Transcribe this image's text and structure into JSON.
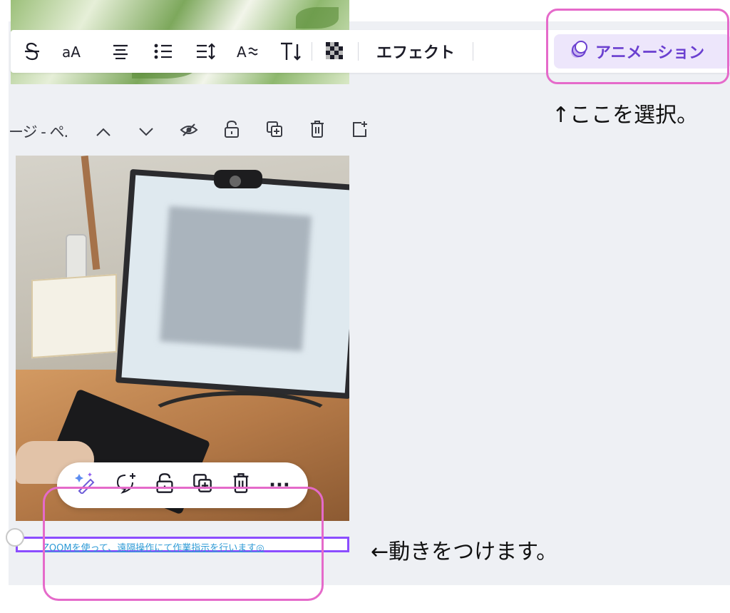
{
  "toolbar": {
    "icons": [
      "strikethrough-icon",
      "letter-case-icon",
      "align-icon",
      "list-icon",
      "spacing-icon",
      "font-style-icon",
      "text-direction-icon"
    ],
    "effects_label": "エフェクト",
    "animation_label": "アニメーション"
  },
  "annotations": {
    "top_note": "↑ここを選択。",
    "bottom_note": "←動きをつけます。"
  },
  "page_controls": {
    "label": "ージ - ペ.",
    "icons": [
      "chevron-up-icon",
      "chevron-down-icon",
      "hide-icon",
      "lock-icon",
      "duplicate-icon",
      "delete-icon",
      "add-page-icon"
    ]
  },
  "canvas_text": {
    "line": "ZOOMを使って、遠隔操作にて作業指示を行います◎"
  },
  "floating_toolbar": {
    "icons": [
      "magic-edit-icon",
      "add-comment-icon",
      "lock-icon",
      "duplicate-icon",
      "delete-icon",
      "more-icon"
    ],
    "more_label": "···"
  },
  "colors": {
    "highlight": "#e56aca",
    "accent": "#6a3fd0",
    "selection": "#8b4dff",
    "text_link": "#2f9bd6"
  }
}
